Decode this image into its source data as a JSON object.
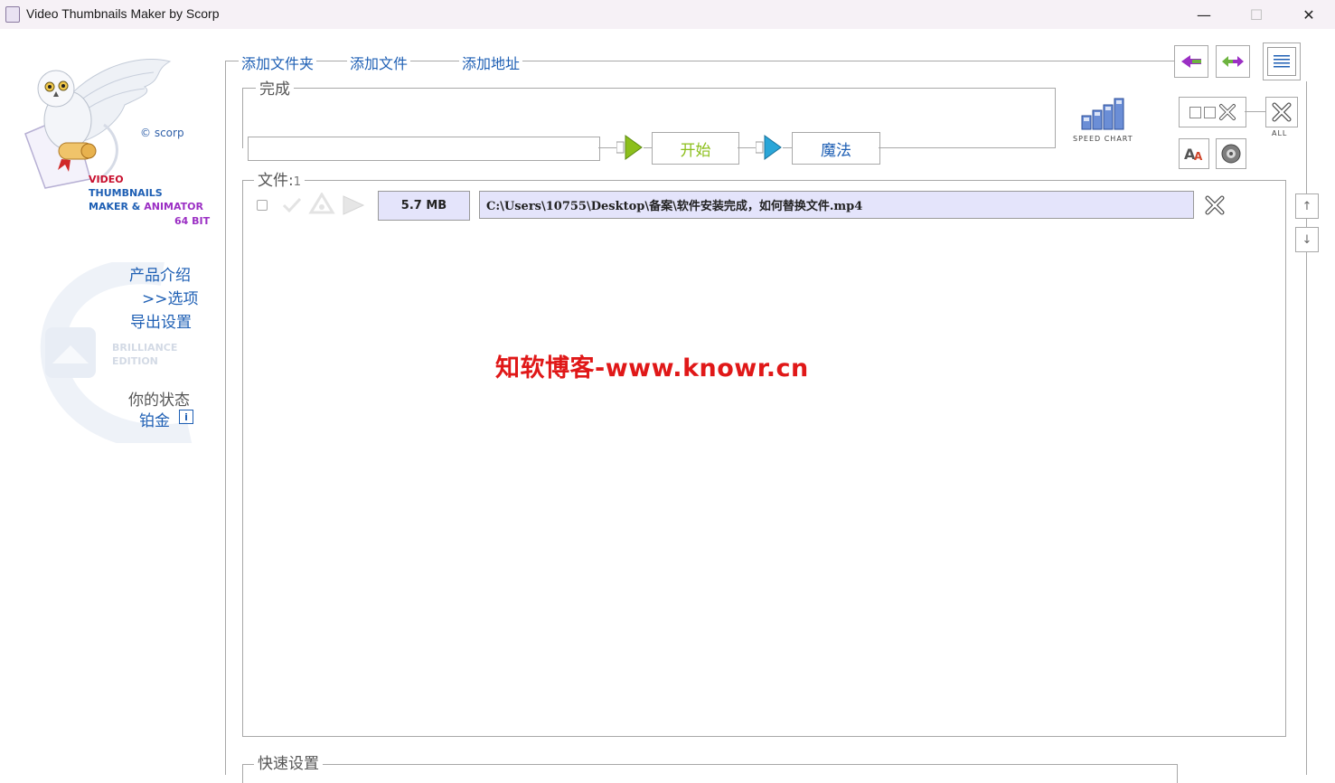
{
  "window": {
    "title": "Video Thumbnails Maker by Scorp",
    "minimize_glyph": "—",
    "maximize_glyph": "☐",
    "close_glyph": "✕"
  },
  "logo": {
    "copyright": "© scorp",
    "line1": "VIDEO",
    "line2": "THUMBNAILS",
    "line3a": "MAKER & ",
    "line3b": "ANIMATOR",
    "line4": "64 BIT",
    "edition_line1": "BRILLIANCE",
    "edition_line2": "EDITION"
  },
  "sidebar": {
    "links": [
      {
        "label": "产品介绍"
      },
      {
        "label": ">>选项"
      },
      {
        "label": "导出设置"
      }
    ],
    "status_label": "你的状态",
    "status_value": "铂金",
    "info_icon": "i"
  },
  "toolbar": {
    "add_folder": "添加文件夹",
    "add_file": "添加文件",
    "add_url": "添加地址"
  },
  "progress": {
    "legend": "完成",
    "start_label": "开始",
    "magic_label": "魔法",
    "speed_chart_label": "SPEED CHART"
  },
  "right_tools": {
    "all_label": "ALL"
  },
  "files": {
    "legend_prefix": "文件:",
    "count": "1",
    "rows": [
      {
        "size": "5.7 MB",
        "path": "C:\\Users\\10755\\Desktop\\备案\\软件安装完成，如何替换文件.mp4"
      }
    ]
  },
  "quick_settings": {
    "legend": "快速设置"
  },
  "watermark": "知软博客-www.knowr.cn",
  "colors": {
    "accent_blue": "#1e5fb4",
    "start_green": "#8cbf1c",
    "watermark_red": "#e01818",
    "path_bg": "#e4e4fb",
    "logo_red": "#c8102e",
    "logo_blue": "#1e5fb4",
    "logo_purple": "#9b2fc4"
  }
}
